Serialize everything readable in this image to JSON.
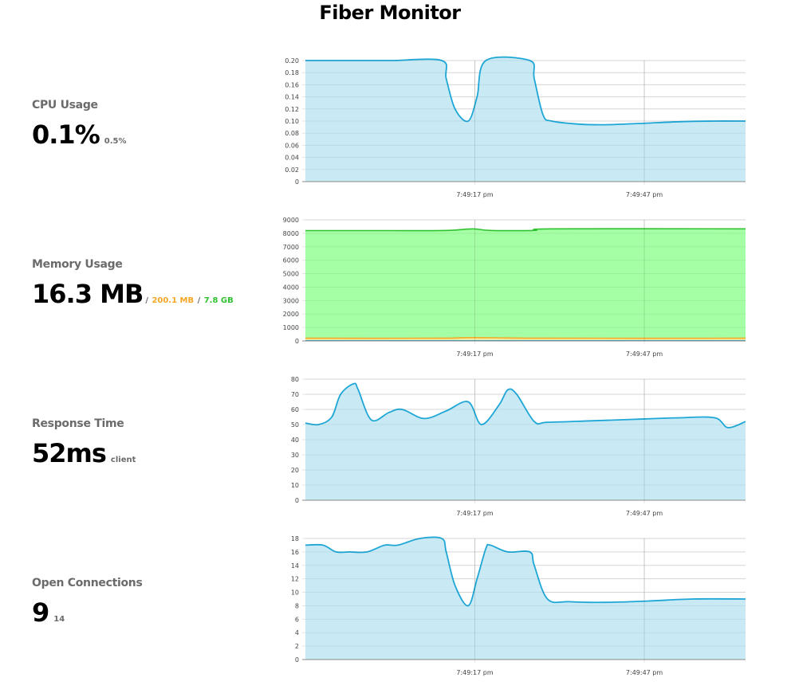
{
  "page": {
    "title": "Fiber Monitor"
  },
  "metrics": {
    "cpu": {
      "label": "CPU Usage",
      "value": "0.1%",
      "sub": "0.5%"
    },
    "memory": {
      "label": "Memory Usage",
      "value": "16.3 MB",
      "sep": "/",
      "sub1": "200.1 MB",
      "sub2": "7.8 GB",
      "colors": {
        "sub1": "#f5a623",
        "sub2": "#2fc12f"
      }
    },
    "response": {
      "label": "Response Time",
      "value": "52ms",
      "sub": "client"
    },
    "connections": {
      "label": "Open Connections",
      "value": "9",
      "sub": "14"
    }
  },
  "colors": {
    "line": "#1ea7d6",
    "fill_blue": "#c6e9f4",
    "fill_green": "#a0ff9f",
    "line_green": "#2fc12f",
    "line_orange": "#f5a623",
    "grid": "#e3e3e3"
  },
  "chart_data": [
    {
      "type": "area",
      "ylim": [
        0,
        0.2
      ],
      "yticks": [
        "0",
        "0.02",
        "0.04",
        "0.06",
        "0.08",
        "0.10",
        "0.12",
        "0.14",
        "0.16",
        "0.18",
        "0.20"
      ],
      "xticks": [
        "7:49:17 pm",
        "7:49:47 pm"
      ],
      "series": [
        {
          "values": [
            [
              0,
              0.2
            ],
            [
              15,
              0.2
            ],
            [
              20,
              0.2
            ],
            [
              31,
              0.2
            ],
            [
              32,
              0.17
            ],
            [
              34,
              0.12
            ],
            [
              37,
              0.1
            ],
            [
              39,
              0.14
            ],
            [
              41,
              0.2
            ],
            [
              51,
              0.2
            ],
            [
              52,
              0.17
            ],
            [
              54,
              0.11
            ],
            [
              56,
              0.1
            ],
            [
              62,
              0.095
            ],
            [
              68,
              0.094
            ],
            [
              76,
              0.096
            ],
            [
              85,
              0.099
            ],
            [
              93,
              0.1
            ],
            [
              100,
              0.1
            ]
          ]
        }
      ]
    },
    {
      "type": "area",
      "ylim": [
        0,
        9000
      ],
      "yticks": [
        "0",
        "1000",
        "2000",
        "3000",
        "4000",
        "5000",
        "6000",
        "7000",
        "8000",
        "9000"
      ],
      "xticks": [
        "7:49:17 pm",
        "7:49:47 pm"
      ],
      "series": [
        {
          "values": [
            [
              0,
              8200
            ],
            [
              20,
              8200
            ],
            [
              32,
              8210
            ],
            [
              38,
              8330
            ],
            [
              42,
              8210
            ],
            [
              52,
              8210
            ],
            [
              56,
              8330
            ],
            [
              100,
              8330
            ]
          ]
        },
        {
          "values": [
            [
              0,
              200
            ],
            [
              30,
              200
            ],
            [
              38,
              240
            ],
            [
              55,
              200
            ],
            [
              100,
              200
            ]
          ]
        },
        {
          "values": [
            [
              0,
              16
            ],
            [
              100,
              16
            ]
          ]
        }
      ]
    },
    {
      "type": "area",
      "ylim": [
        0,
        80
      ],
      "yticks": [
        "0",
        "10",
        "20",
        "30",
        "40",
        "50",
        "60",
        "70",
        "80"
      ],
      "xticks": [
        "7:49:17 pm",
        "7:49:47 pm"
      ],
      "series": [
        {
          "values": [
            [
              0,
              51
            ],
            [
              3,
              50
            ],
            [
              6,
              55
            ],
            [
              8,
              70
            ],
            [
              11,
              77
            ],
            [
              12,
              73
            ],
            [
              15,
              53
            ],
            [
              19,
              58
            ],
            [
              22,
              60
            ],
            [
              27,
              54
            ],
            [
              32,
              59
            ],
            [
              37,
              65
            ],
            [
              40,
              50
            ],
            [
              44,
              63
            ],
            [
              46,
              73
            ],
            [
              48,
              70
            ],
            [
              52,
              52
            ],
            [
              55,
              51.5
            ],
            [
              65,
              52.5
            ],
            [
              75,
              53.5
            ],
            [
              85,
              54.5
            ],
            [
              93,
              54.5
            ],
            [
              96,
              48
            ],
            [
              100,
              52
            ]
          ]
        }
      ]
    },
    {
      "type": "area",
      "ylim": [
        0,
        18
      ],
      "yticks": [
        "0",
        "2",
        "4",
        "6",
        "8",
        "10",
        "12",
        "14",
        "16",
        "18"
      ],
      "xticks": [
        "7:49:17 pm",
        "7:49:47 pm"
      ],
      "series": [
        {
          "values": [
            [
              0,
              17
            ],
            [
              4,
              17
            ],
            [
              7,
              16
            ],
            [
              10,
              16
            ],
            [
              14,
              16
            ],
            [
              18,
              17
            ],
            [
              21,
              17
            ],
            [
              26,
              18
            ],
            [
              31,
              18
            ],
            [
              32,
              16
            ],
            [
              34,
              11
            ],
            [
              37,
              8
            ],
            [
              39,
              12
            ],
            [
              41,
              16.5
            ],
            [
              42,
              17
            ],
            [
              46,
              16
            ],
            [
              51,
              16
            ],
            [
              52,
              14
            ],
            [
              55,
              9
            ],
            [
              60,
              8.6
            ],
            [
              68,
              8.5
            ],
            [
              78,
              8.7
            ],
            [
              88,
              9
            ],
            [
              100,
              9
            ]
          ]
        }
      ]
    }
  ]
}
